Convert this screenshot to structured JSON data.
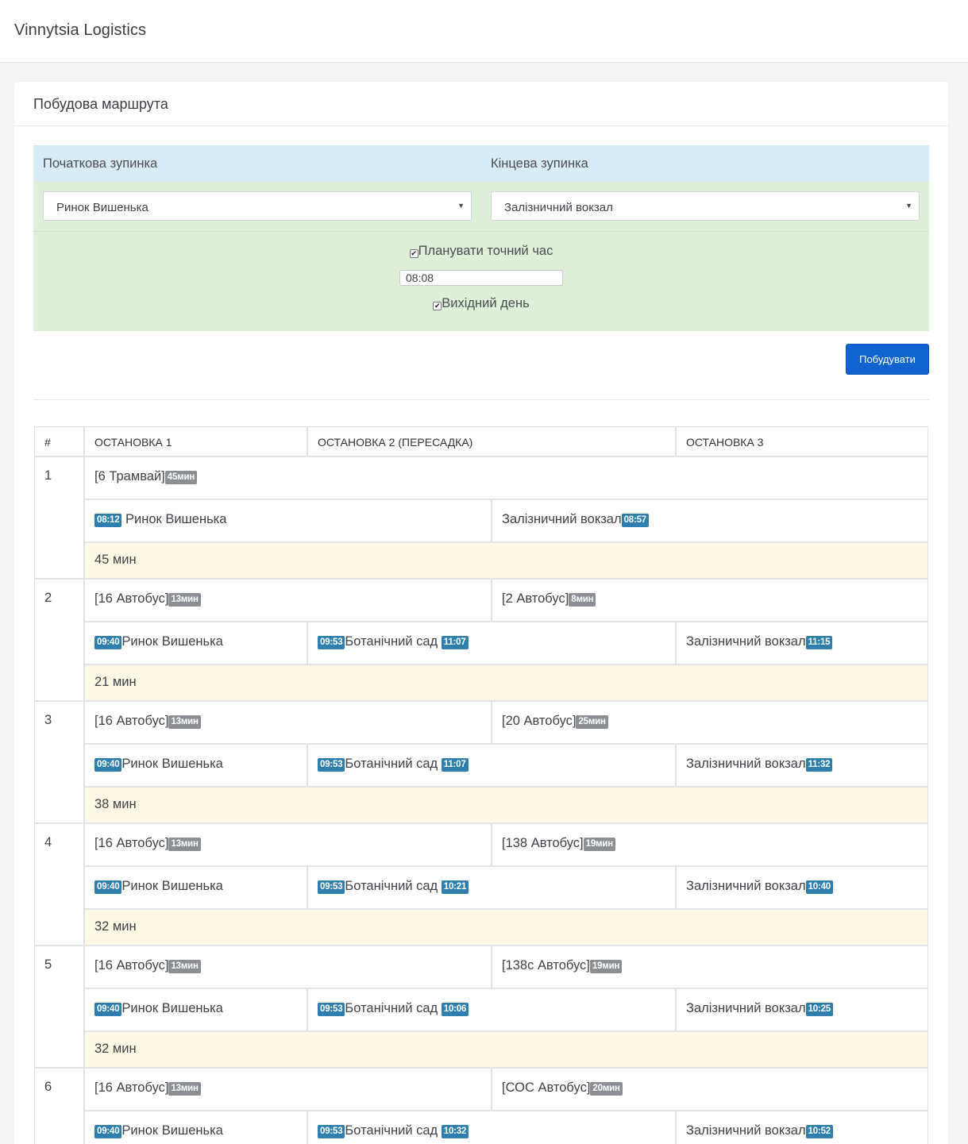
{
  "app": {
    "brand": "Vinnytsia Logistics"
  },
  "card": {
    "title": "Побудова маршрута"
  },
  "form": {
    "start_label": "Початкова зупинка",
    "end_label": "Кінцева зупинка",
    "start_value": "Ринок Вишенька",
    "end_value": "Залізничний вокзал",
    "plan_exact_label": "Планувати точний час",
    "time_value": "08:08",
    "weekend_label": "Вихідний день",
    "build_button": "Побудувати"
  },
  "table": {
    "headers": [
      "#",
      "ОСТАНОВКА 1",
      "ОСТАНОВКА 2 (ПЕРЕСАДКА)",
      "ОСТАНОВКА 3"
    ],
    "routes": [
      {
        "num": "1",
        "direct": true,
        "legs": [
          {
            "name": "[6 Трамвай]",
            "dur": "45мин"
          }
        ],
        "stop1": {
          "time": "08:12",
          "name": "Ринок Вишенька"
        },
        "stop3": {
          "name": "Залізничний вокзал",
          "time": "08:57"
        },
        "total": "45 мин"
      },
      {
        "num": "2",
        "legs": [
          {
            "name": "[16 Автобус]",
            "dur": "13мин"
          },
          {
            "name": "[2 Автобус]",
            "dur": "8мин"
          }
        ],
        "stop1": {
          "time": "09:40",
          "name": "Ринок Вишенька"
        },
        "stop2": {
          "arr": "09:53",
          "name": "Ботанічний сад",
          "dep": "11:07"
        },
        "stop3": {
          "name": "Залізничний вокзал",
          "time": "11:15"
        },
        "total": "21 мин"
      },
      {
        "num": "3",
        "legs": [
          {
            "name": "[16 Автобус]",
            "dur": "13мин"
          },
          {
            "name": "[20 Автобус]",
            "dur": "25мин"
          }
        ],
        "stop1": {
          "time": "09:40",
          "name": "Ринок Вишенька"
        },
        "stop2": {
          "arr": "09:53",
          "name": "Ботанічний сад",
          "dep": "11:07"
        },
        "stop3": {
          "name": "Залізничний вокзал",
          "time": "11:32"
        },
        "total": "38 мин"
      },
      {
        "num": "4",
        "legs": [
          {
            "name": "[16 Автобус]",
            "dur": "13мин"
          },
          {
            "name": "[138 Автобус]",
            "dur": "19мин"
          }
        ],
        "stop1": {
          "time": "09:40",
          "name": "Ринок Вишенька"
        },
        "stop2": {
          "arr": "09:53",
          "name": "Ботанічний сад",
          "dep": "10:21"
        },
        "stop3": {
          "name": "Залізничний вокзал",
          "time": "10:40"
        },
        "total": "32 мин"
      },
      {
        "num": "5",
        "legs": [
          {
            "name": "[16 Автобус]",
            "dur": "13мин"
          },
          {
            "name": "[138с Автобус]",
            "dur": "19мин"
          }
        ],
        "stop1": {
          "time": "09:40",
          "name": "Ринок Вишенька"
        },
        "stop2": {
          "arr": "09:53",
          "name": "Ботанічний сад",
          "dep": "10:06"
        },
        "stop3": {
          "name": "Залізничний вокзал",
          "time": "10:25"
        },
        "total": "32 мин"
      },
      {
        "num": "6",
        "legs": [
          {
            "name": "[16 Автобус]",
            "dur": "13мин"
          },
          {
            "name": "[СОС Автобус]",
            "dur": "20мин"
          }
        ],
        "stop1": {
          "time": "09:40",
          "name": "Ринок Вишенька"
        },
        "stop2": {
          "arr": "09:53",
          "name": "Ботанічний сад",
          "dep": "10:32"
        },
        "stop3": {
          "name": "Залізничний вокзал",
          "time": "10:52"
        },
        "total": ""
      }
    ]
  }
}
